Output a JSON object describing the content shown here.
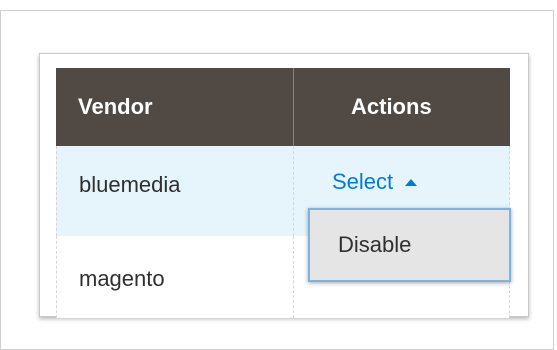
{
  "table": {
    "headers": {
      "vendor": "Vendor",
      "actions": "Actions"
    },
    "rows": [
      {
        "vendor": "bluemedia",
        "action_label": "Select",
        "selected": true
      },
      {
        "vendor": "magento",
        "action_label": "",
        "selected": false
      }
    ]
  },
  "dropdown": {
    "items": [
      "Disable"
    ]
  },
  "icons": {
    "select_caret": "caret-up-icon"
  },
  "colors": {
    "header_bg": "#514943",
    "header_text": "#ffffff",
    "selected_row_bg": "#e6f5fc",
    "link": "#007bdb",
    "dropdown_bg": "#e5e5e5",
    "dropdown_border": "#7ab4e2"
  }
}
